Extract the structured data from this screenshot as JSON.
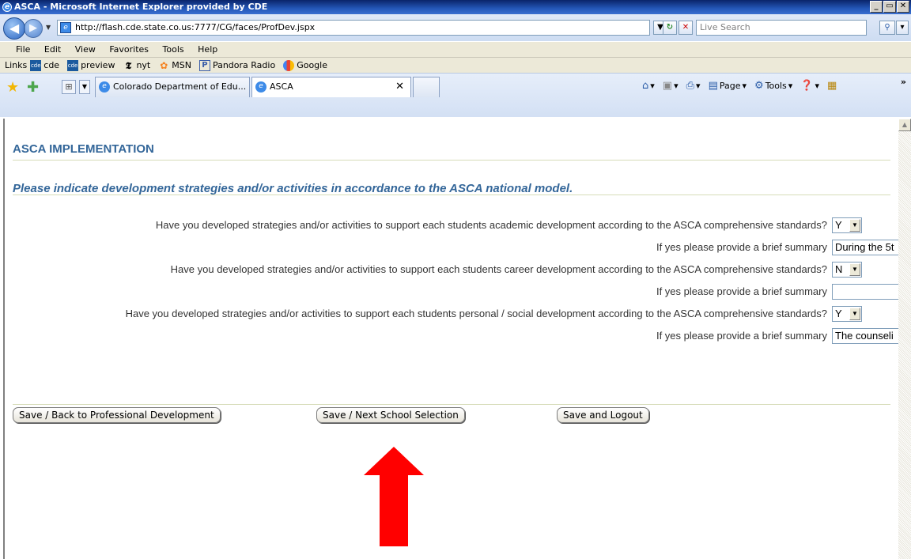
{
  "window": {
    "title": "ASCA - Microsoft Internet Explorer provided by CDE",
    "controls": [
      "_",
      "̅",
      "x"
    ]
  },
  "address": {
    "url": "http://flash.cde.state.co.us:7777/CG/faces/ProfDev.jspx",
    "search_placeholder": "Live Search"
  },
  "menu": [
    "File",
    "Edit",
    "View",
    "Favorites",
    "Tools",
    "Help"
  ],
  "links": {
    "label": "Links",
    "items": [
      {
        "label": "cde",
        "icon": "cde-icon"
      },
      {
        "label": "preview",
        "icon": "cde-icon"
      },
      {
        "label": "nyt",
        "icon": "nyt-icon"
      },
      {
        "label": "MSN",
        "icon": "msn-butterfly-icon"
      },
      {
        "label": "Pandora Radio",
        "icon": "pandora-icon"
      },
      {
        "label": "Google",
        "icon": "google-icon"
      }
    ]
  },
  "tabs": [
    {
      "label": "Colorado Department of Edu...",
      "active": false
    },
    {
      "label": "ASCA",
      "active": true
    }
  ],
  "commandbar": {
    "page": "Page",
    "tools": "Tools"
  },
  "page": {
    "heading": "ASCA IMPLEMENTATION",
    "subheading": "Please indicate development strategies and/or activities in accordance to the ASCA national model.",
    "questions": [
      {
        "question": "Have you developed strategies and/or activities to support each students academic development according to the ASCA comprehensive standards?",
        "answer": "Y",
        "summary_label": "If yes please provide a brief summary",
        "summary_value": "During the 5t"
      },
      {
        "question": "Have you developed strategies and/or activities to support each students career development according to the ASCA comprehensive standards?",
        "answer": "N",
        "summary_label": "If yes please provide a brief summary",
        "summary_value": ""
      },
      {
        "question": "Have you developed strategies and/or activities to support each students personal / social development according to the ASCA comprehensive standards?",
        "answer": "Y",
        "summary_label": "If yes please provide a brief summary",
        "summary_value": "The counseli"
      }
    ],
    "buttons": {
      "back": "Save / Back to Professional Development",
      "next": "Save / Next School Selection",
      "logout": "Save and Logout"
    },
    "annotation_color": "#ff0000"
  }
}
